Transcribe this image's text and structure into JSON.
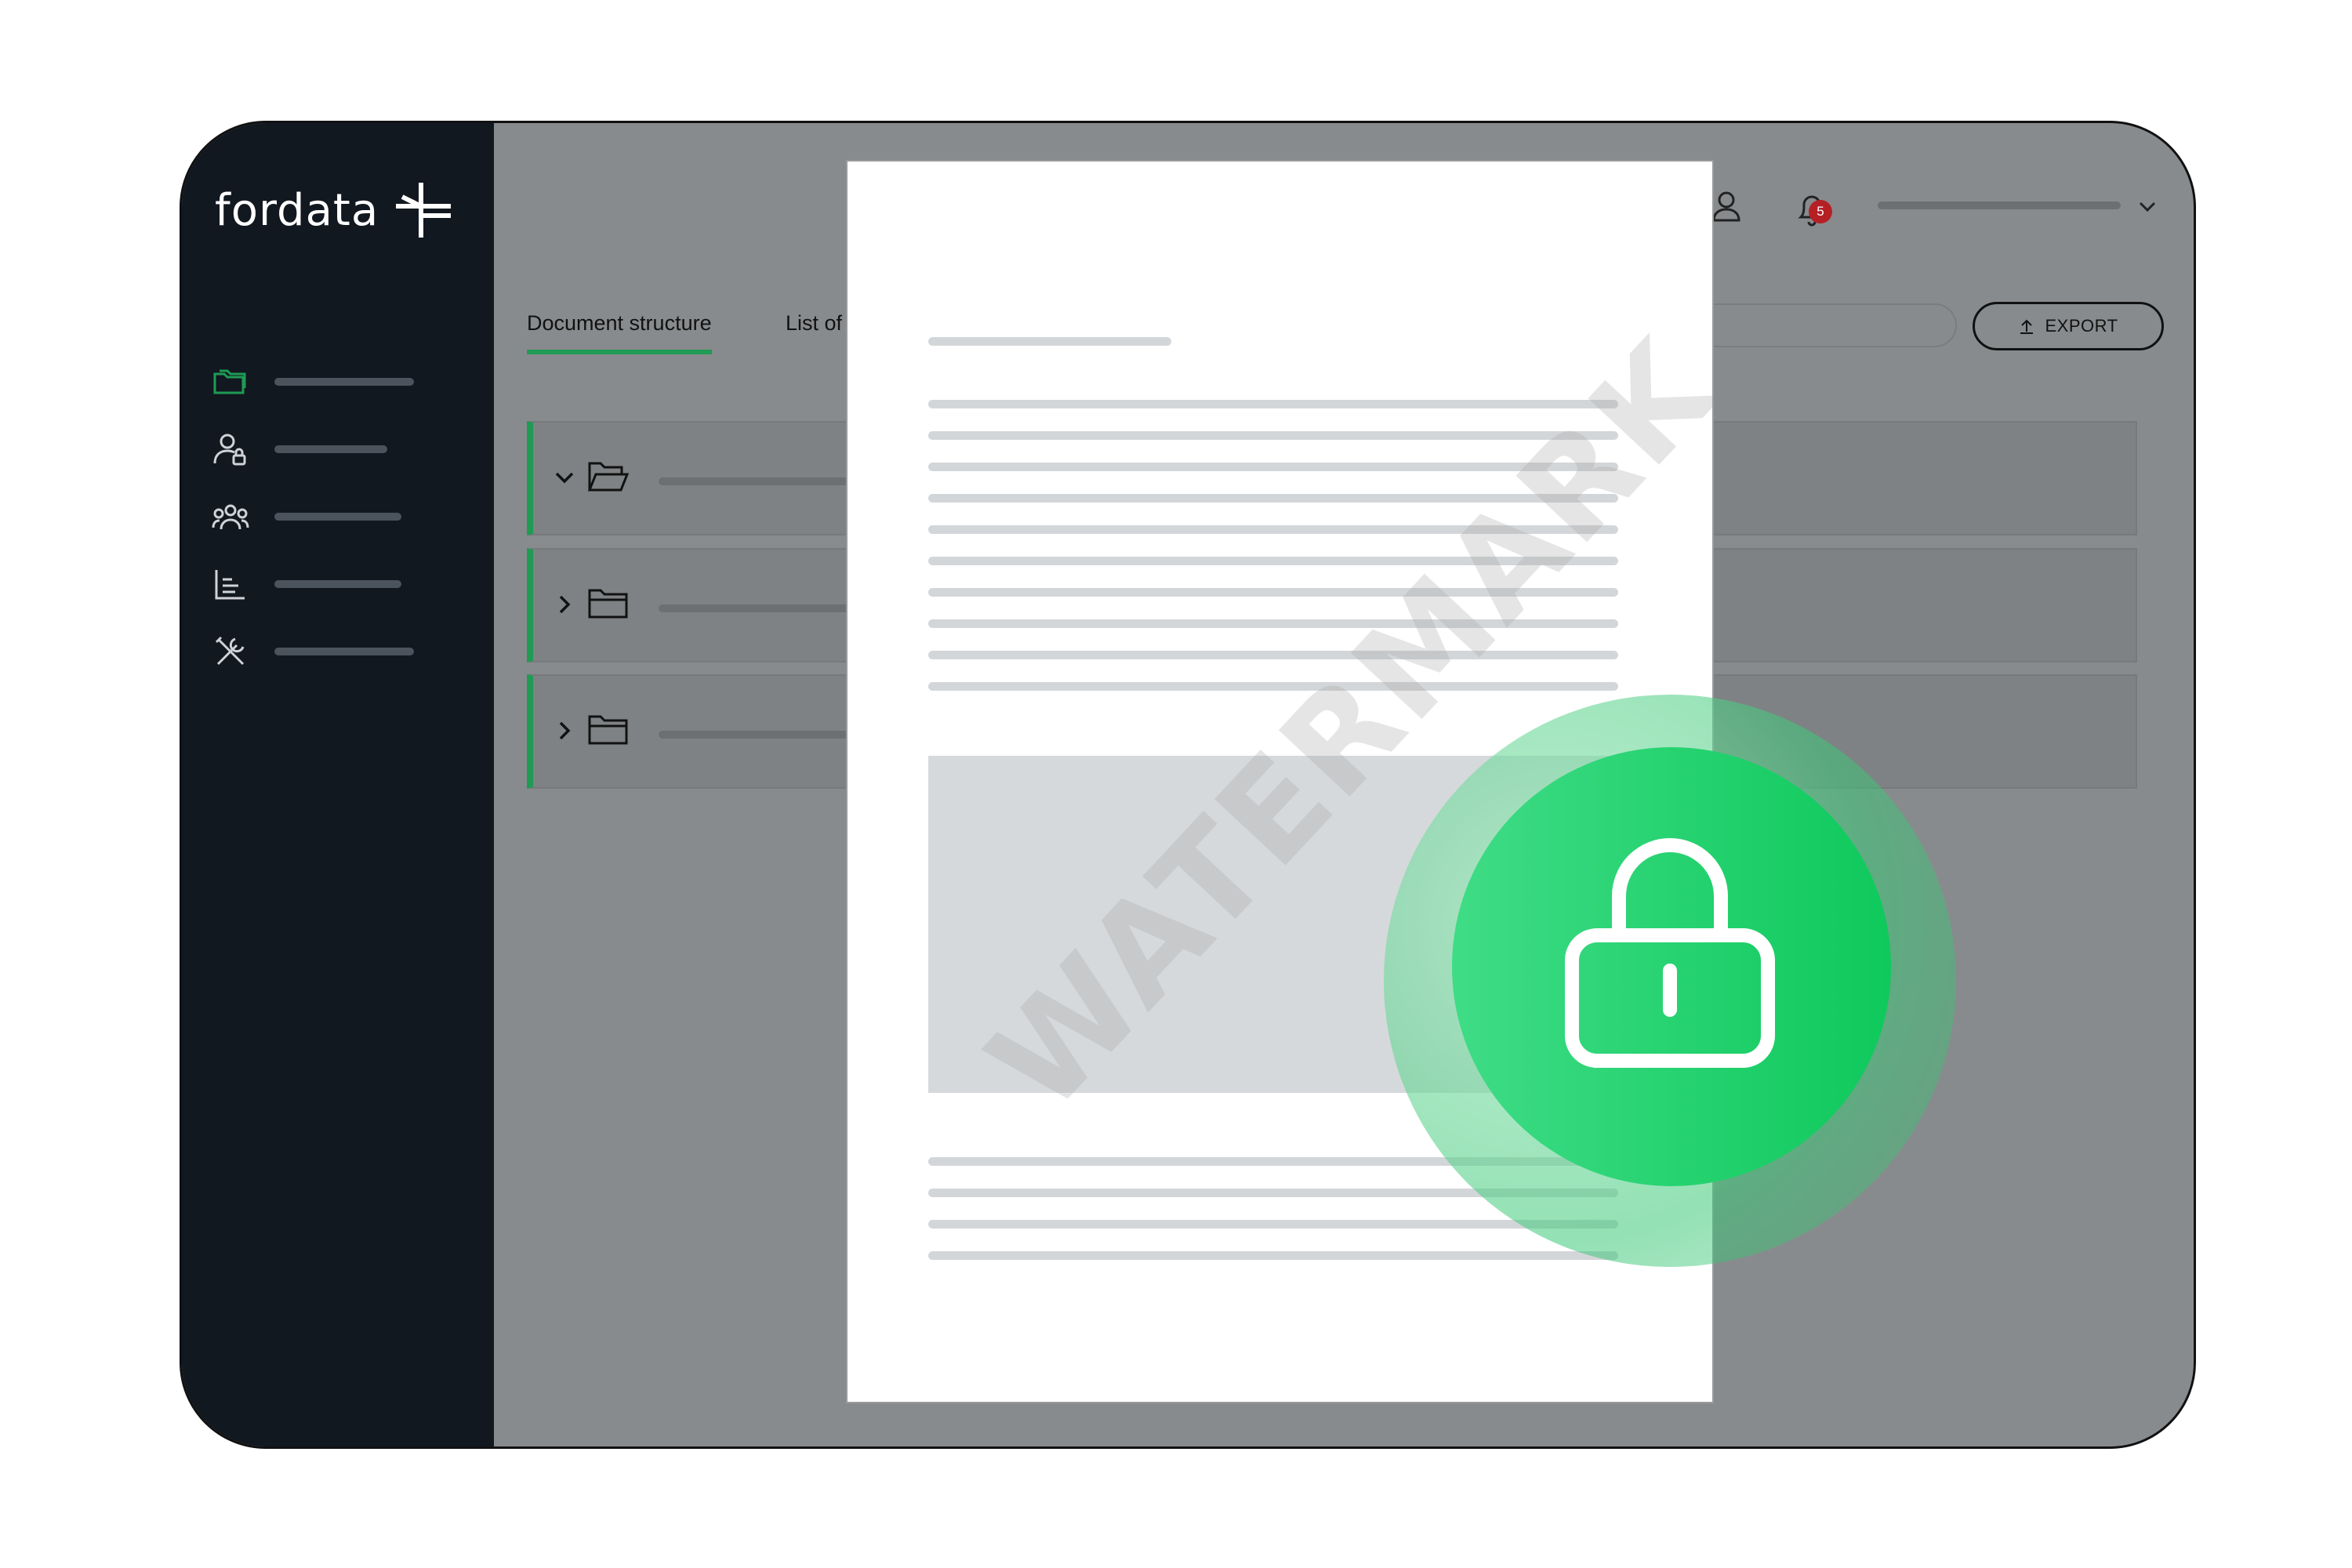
{
  "app": {
    "logo_text": "fordata"
  },
  "tabs": [
    {
      "label": "Document structure",
      "active": true
    },
    {
      "label": "List of",
      "active": false
    }
  ],
  "toolbar": {
    "export_label": "EXPORT"
  },
  "header": {
    "notification_count": "5"
  },
  "sidebar": {
    "items": [
      {
        "icon": "folders-icon",
        "active": true
      },
      {
        "icon": "user-lock-icon",
        "active": false
      },
      {
        "icon": "users-icon",
        "active": false
      },
      {
        "icon": "report-icon",
        "active": false
      },
      {
        "icon": "tools-icon",
        "active": false
      }
    ]
  },
  "tree": [
    {
      "expanded": true,
      "icon": "folder-open-icon"
    },
    {
      "expanded": false,
      "icon": "folder-icon"
    },
    {
      "expanded": false,
      "icon": "folder-icon"
    }
  ],
  "document": {
    "watermark": "WATERMARK"
  },
  "colors": {
    "accent": "#1f9b54",
    "sidebar_bg": "#121820",
    "lock_green": "#15c95f",
    "badge_red": "#b52025"
  }
}
